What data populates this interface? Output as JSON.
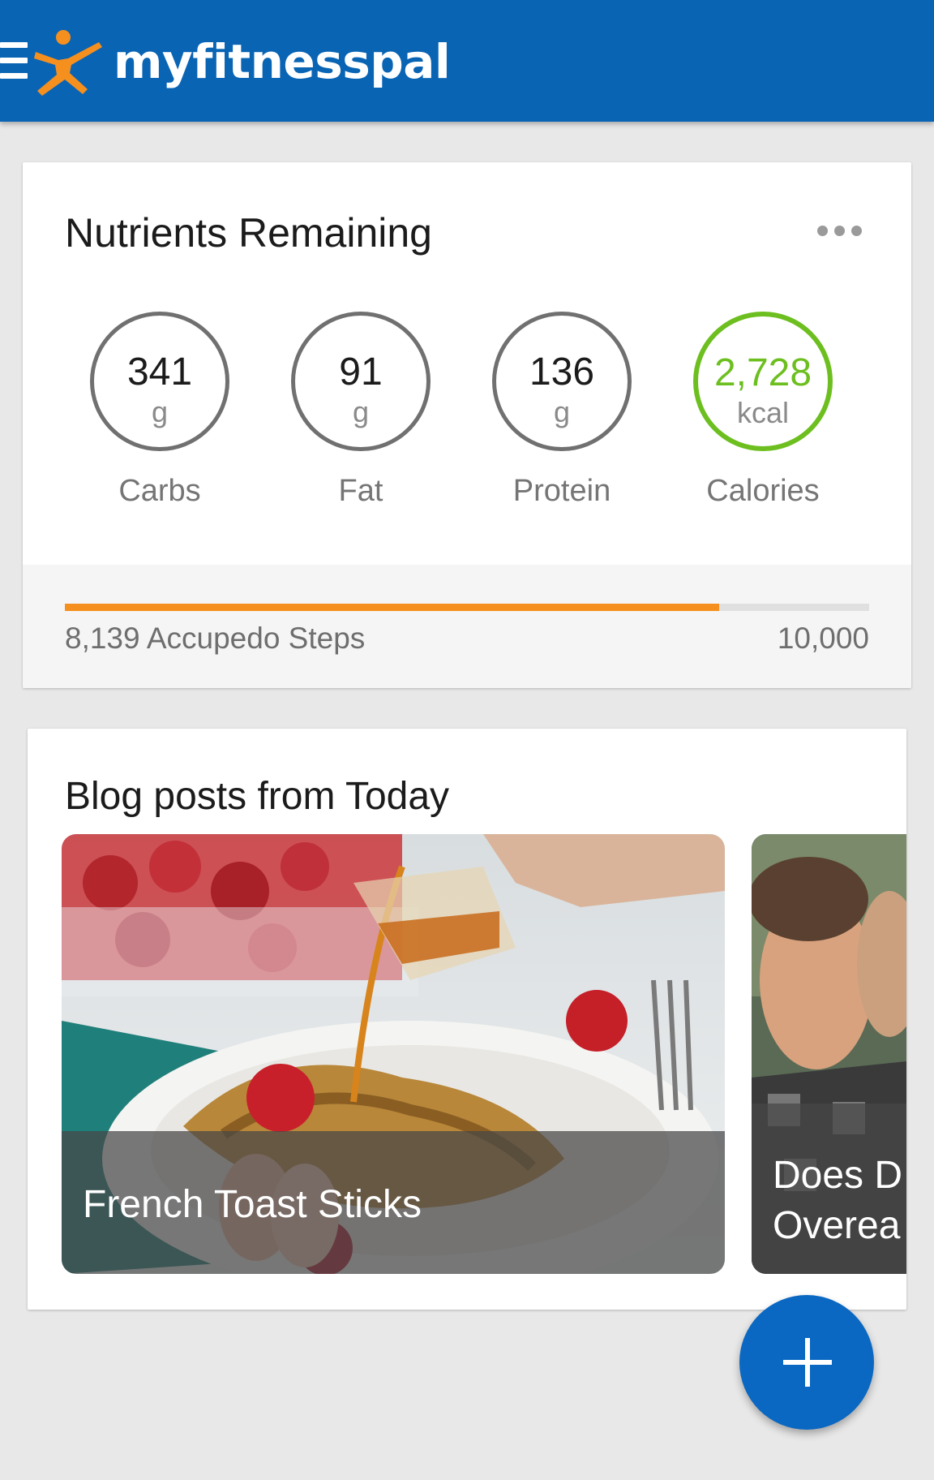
{
  "app": {
    "brand": "myfitnesspal",
    "colors": {
      "appbar": "#0a64b4",
      "accent_green": "#6cbf1f",
      "progress": "#f5901e",
      "fab": "#0a68c2"
    },
    "icons": {
      "menu": "hamburger-menu-icon",
      "logo": "running-figure-logo",
      "more": "more-horizontal-icon",
      "fab": "plus-icon"
    }
  },
  "nutrients_card": {
    "title": "Nutrients Remaining",
    "items": [
      {
        "value": "341",
        "unit": "g",
        "label": "Carbs"
      },
      {
        "value": "91",
        "unit": "g",
        "label": "Fat"
      },
      {
        "value": "136",
        "unit": "g",
        "label": "Protein"
      },
      {
        "value": "2,728",
        "unit": "kcal",
        "label": "Calories",
        "highlight": true
      }
    ],
    "steps": {
      "label": "8,139 Accupedo Steps",
      "goal": "10,000",
      "progress_fraction": 0.8139
    }
  },
  "blog_card": {
    "title": "Blog posts from Today",
    "posts": [
      {
        "title": "French Toast Sticks"
      },
      {
        "title": "Does D\nOverea"
      }
    ]
  }
}
